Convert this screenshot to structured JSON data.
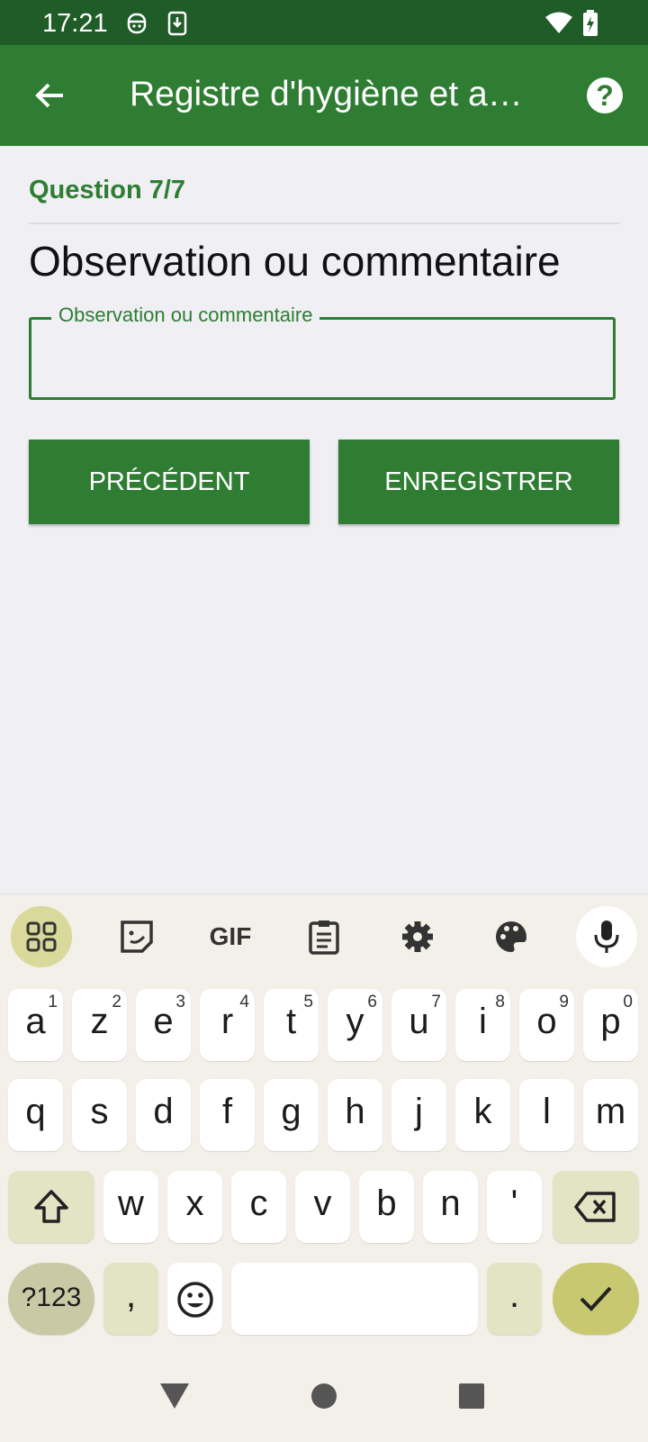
{
  "status": {
    "time": "17:21"
  },
  "appbar": {
    "title": "Registre d'hygiène et a…"
  },
  "question": {
    "counter": "Question 7/7",
    "title": "Observation ou commentaire"
  },
  "field": {
    "label": "Observation ou commentaire",
    "value": ""
  },
  "buttons": {
    "previous": "PRÉCÉDENT",
    "save": "ENREGISTRER"
  },
  "keyboard": {
    "toolbar": [
      "apps-grid-icon",
      "sticker-icon",
      "gif-icon",
      "clipboard-icon",
      "gear-icon",
      "palette-icon",
      "mic-icon"
    ],
    "gif_label": "GIF",
    "row1": [
      {
        "k": "a",
        "h": "1"
      },
      {
        "k": "z",
        "h": "2"
      },
      {
        "k": "e",
        "h": "3"
      },
      {
        "k": "r",
        "h": "4"
      },
      {
        "k": "t",
        "h": "5"
      },
      {
        "k": "y",
        "h": "6"
      },
      {
        "k": "u",
        "h": "7"
      },
      {
        "k": "i",
        "h": "8"
      },
      {
        "k": "o",
        "h": "9"
      },
      {
        "k": "p",
        "h": "0"
      }
    ],
    "row2": [
      "q",
      "s",
      "d",
      "f",
      "g",
      "h",
      "j",
      "k",
      "l",
      "m"
    ],
    "row3": [
      "w",
      "x",
      "c",
      "v",
      "b",
      "n",
      "'"
    ],
    "symbols_label": "?123",
    "comma": ",",
    "period": "."
  },
  "colors": {
    "primary": "#2e7d32",
    "status_bar": "#1f5c28",
    "key_mod": "#e3e4c4",
    "enter": "#c8c870"
  }
}
